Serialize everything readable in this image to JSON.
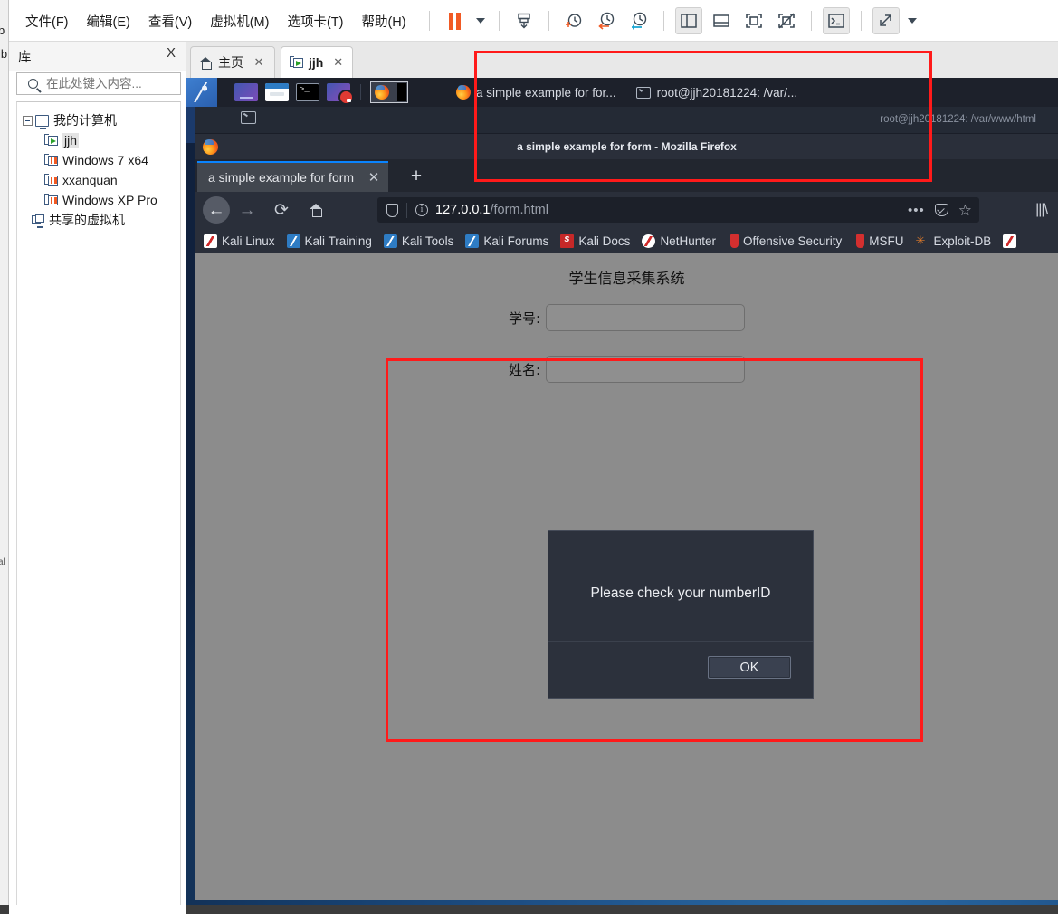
{
  "host": {
    "menu": [
      {
        "label": "文件(F)",
        "name": "menu-file"
      },
      {
        "label": "编辑(E)",
        "name": "menu-edit"
      },
      {
        "label": "查看(V)",
        "name": "menu-view"
      },
      {
        "label": "虚拟机(M)",
        "name": "menu-vm"
      },
      {
        "label": "选项卡(T)",
        "name": "menu-tabs"
      },
      {
        "label": "帮助(H)",
        "name": "menu-help"
      }
    ],
    "toolbar": [
      {
        "name": "pause-button",
        "icon": "pause-icon"
      },
      {
        "name": "pause-dropdown",
        "icon": "chevron-down-icon"
      },
      {
        "name": "snapshot-take-button",
        "icon": "snapshot-icon"
      },
      {
        "name": "snapshot-add-button",
        "icon": "clock-plus-icon"
      },
      {
        "name": "snapshot-revert-button",
        "icon": "clock-back-icon"
      },
      {
        "name": "snapshot-manager-button",
        "icon": "clock-wrench-icon"
      },
      {
        "name": "show-library-button",
        "icon": "panel-left-icon"
      },
      {
        "name": "show-thumbnail-bar-button",
        "icon": "panel-bottom-icon"
      },
      {
        "name": "fullscreen-button",
        "icon": "fullscreen-icon"
      },
      {
        "name": "unity-button",
        "icon": "unity-icon"
      },
      {
        "name": "console-button",
        "icon": "terminal-icon"
      },
      {
        "name": "stretch-button",
        "icon": "expand-arrows-icon"
      },
      {
        "name": "stretch-dropdown",
        "icon": "chevron-down-icon"
      }
    ],
    "behind_window_fragments": [
      "b",
      "ib",
      "al"
    ],
    "library": {
      "title": "库",
      "close_label": "X",
      "search_placeholder": "在此处键入内容...",
      "search_value": "",
      "tree": [
        {
          "label": "我的计算机",
          "icon": "computer-icon",
          "indent": 0,
          "expander": true,
          "selected": false
        },
        {
          "label": "jjh",
          "icon": "vm-running-icon",
          "indent": 1,
          "expander": false,
          "selected": true
        },
        {
          "label": "Windows 7 x64",
          "icon": "vm-suspended-icon",
          "indent": 1,
          "expander": false,
          "selected": false
        },
        {
          "label": "xxanquan",
          "icon": "vm-suspended-icon",
          "indent": 1,
          "expander": false,
          "selected": false
        },
        {
          "label": "Windows XP Pro",
          "icon": "vm-suspended-icon",
          "indent": 1,
          "expander": false,
          "selected": false
        },
        {
          "label": "共享的虚拟机",
          "icon": "shared-vms-icon",
          "indent": 0,
          "expander": false,
          "selected": false
        }
      ]
    },
    "vm_tabs": [
      {
        "label": "主页",
        "icon": "home-icon",
        "active": false,
        "close_label": "✕"
      },
      {
        "label": "jjh",
        "icon": "vm-running-icon",
        "active": true,
        "close_label": "✕"
      }
    ]
  },
  "guest": {
    "panel": {
      "logo_name": "kali-dragon-logo",
      "launchers": [
        {
          "name": "launcher-browser",
          "icon": "browser-icon"
        },
        {
          "name": "launcher-files",
          "icon": "folder-icon"
        },
        {
          "name": "launcher-terminal",
          "icon": "terminal-icon"
        },
        {
          "name": "launcher-screen-recorder",
          "icon": "record-screen-icon"
        }
      ],
      "window_buttons": [
        {
          "label": "a simple example for for...",
          "icon": "firefox-icon",
          "focused": true
        },
        {
          "label": "root@jjh20181224: /var/...",
          "icon": "terminal-icon",
          "focused": false
        }
      ]
    },
    "terminal_window": {
      "title": "root@jjh20181224: /var/www/html",
      "icon": "terminal-icon"
    },
    "firefox": {
      "window_title": "a simple example for form - Mozilla Firefox",
      "app_icon": "firefox-icon",
      "tab": {
        "title": "a simple example for form",
        "close_label": "✕"
      },
      "new_tab_label": "+",
      "nav": {
        "back_label": "←",
        "forward_label": "→",
        "reload_label": "⟳",
        "home_name": "home-icon"
      },
      "urlbar": {
        "shield_name": "tracking-protection-shield-icon",
        "info_label": "i",
        "host": "127.0.0.1",
        "path": "/form.html",
        "actions": [
          {
            "name": "page-actions-button",
            "label": "•••"
          },
          {
            "name": "pocket-save-button",
            "label": ""
          },
          {
            "name": "bookmark-star-button",
            "label": "☆"
          }
        ]
      },
      "library_button_label": "|||\\",
      "bookmarks": [
        {
          "label": "Kali Linux",
          "icon": "kali-dragon-icon",
          "variant": "red"
        },
        {
          "label": "Kali Training",
          "icon": "kali-dragon-icon",
          "variant": "blue"
        },
        {
          "label": "Kali Tools",
          "icon": "kali-dragon-icon",
          "variant": "blue"
        },
        {
          "label": "Kali Forums",
          "icon": "kali-dragon-icon",
          "variant": "blue"
        },
        {
          "label": "Kali Docs",
          "icon": "kali-docs-icon",
          "variant": "docs"
        },
        {
          "label": "NetHunter",
          "icon": "nethunter-icon",
          "variant": "nh"
        },
        {
          "label": "Offensive Security",
          "icon": "offsec-icon",
          "variant": "tube"
        },
        {
          "label": "MSFU",
          "icon": "metasploit-icon",
          "variant": "tube"
        },
        {
          "label": "Exploit-DB",
          "icon": "exploit-db-icon",
          "variant": "spider"
        }
      ],
      "page": {
        "heading": "学生信息采集系统",
        "fields": [
          {
            "label": "学号:",
            "value": "",
            "name": "student-id-input"
          },
          {
            "label": "姓名:",
            "value": "",
            "name": "student-name-input"
          }
        ],
        "alert": {
          "message": "Please check your numberID",
          "ok_label": "OK"
        }
      }
    }
  },
  "annotations": [
    {
      "name": "annotation-rect-taskbar",
      "color": "#ff1a1a"
    },
    {
      "name": "annotation-rect-form-area",
      "color": "#ff1a1a"
    }
  ]
}
